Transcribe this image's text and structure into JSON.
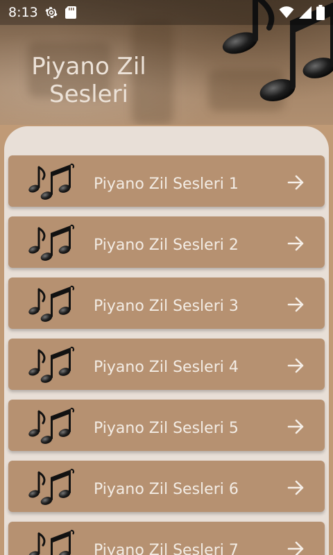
{
  "status_bar": {
    "time": "8:13",
    "left_icons": [
      "settings-gear-icon",
      "sd-card-icon"
    ],
    "right_icons": [
      "wifi-icon",
      "signal-icon",
      "battery-icon"
    ]
  },
  "header": {
    "title_line1": "Piyano Zil",
    "title_line2": "Sesleri"
  },
  "list": {
    "items": [
      {
        "label": "Piyano Zil Sesleri 1"
      },
      {
        "label": "Piyano Zil Sesleri 2"
      },
      {
        "label": "Piyano Zil Sesleri 3"
      },
      {
        "label": "Piyano Zil Sesleri 4"
      },
      {
        "label": "Piyano Zil Sesleri 5"
      },
      {
        "label": "Piyano Zil Sesleri 6"
      },
      {
        "label": "Piyano Zil Sesleri 7"
      }
    ],
    "item_icon": "music-notes-icon",
    "item_action_icon": "arrow-right-icon"
  },
  "colors": {
    "header_bg": "#8d7259",
    "panel_bg": "#e8dfd7",
    "item_bg": "#b69171",
    "item_text": "#f3ece4",
    "title_text": "#ece2d8"
  }
}
